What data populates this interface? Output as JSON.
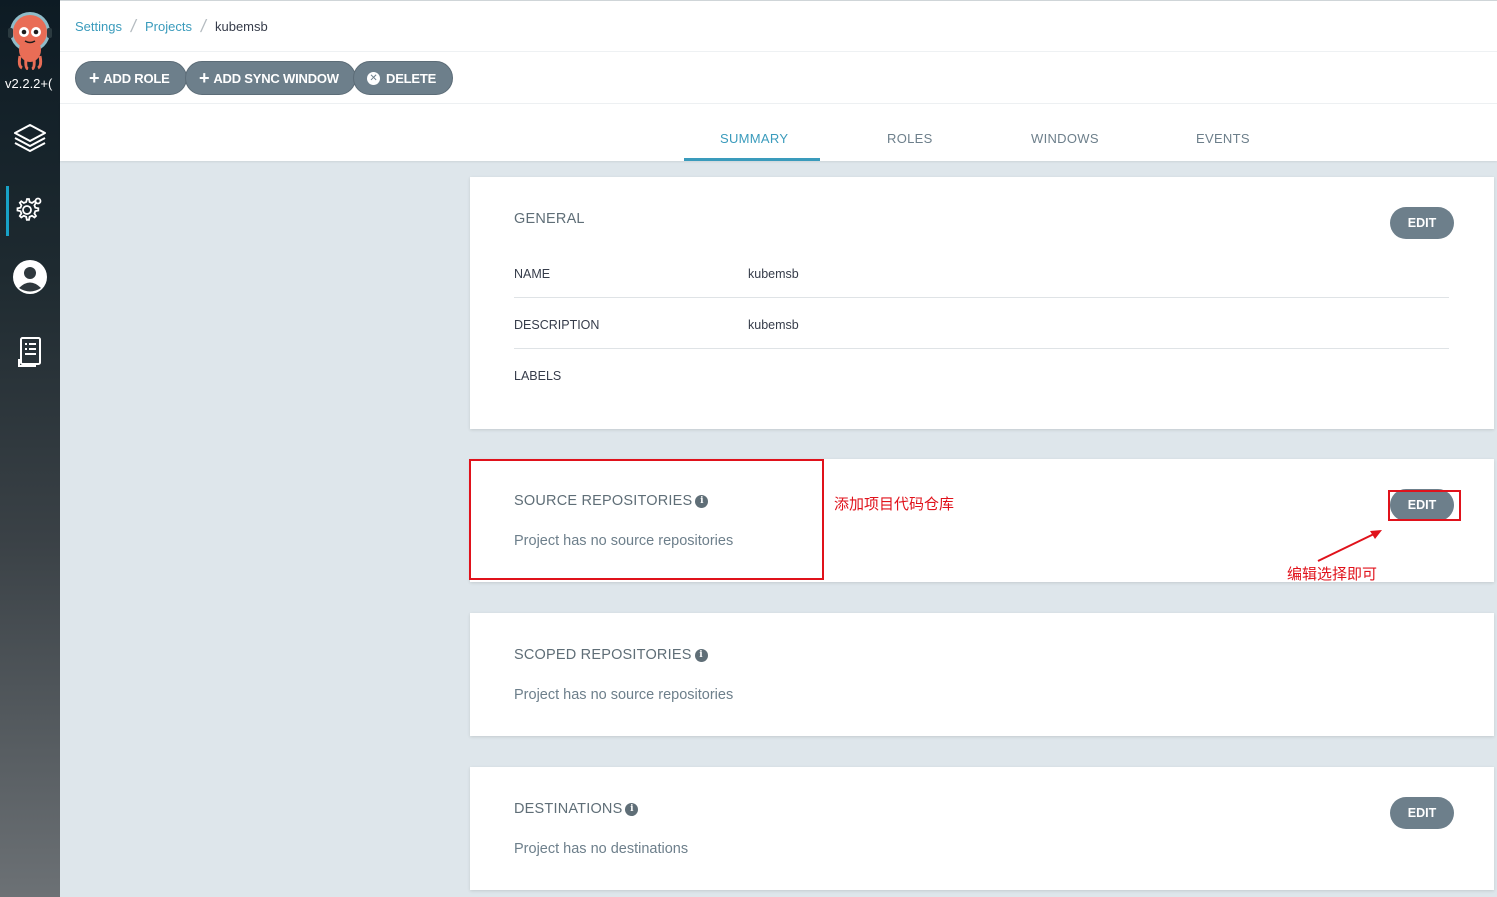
{
  "app": {
    "version": "v2.2.2+("
  },
  "sidebar": {
    "items": [
      {
        "icon": "layers-icon"
      },
      {
        "icon": "gear-icon",
        "active": true
      },
      {
        "icon": "user-icon"
      },
      {
        "icon": "docs-icon"
      }
    ],
    "accent": "#18a2c7"
  },
  "breadcrumb": {
    "settings": "Settings",
    "projects": "Projects",
    "current": "kubemsb"
  },
  "toolbar": {
    "add_role": "ADD ROLE",
    "add_sync_window": "ADD SYNC WINDOW",
    "delete": "DELETE"
  },
  "tabs": {
    "summary": "SUMMARY",
    "roles": "ROLES",
    "windows": "WINDOWS",
    "events": "EVENTS",
    "active": "summary"
  },
  "general": {
    "title": "GENERAL",
    "edit_label": "EDIT",
    "name_key": "NAME",
    "name_value": "kubemsb",
    "description_key": "DESCRIPTION",
    "description_value": "kubemsb",
    "labels_key": "LABELS"
  },
  "source_repos": {
    "title": "SOURCE REPOSITORIES",
    "empty": "Project has no source repositories",
    "edit_label": "EDIT"
  },
  "scoped_repos": {
    "title": "SCOPED REPOSITORIES",
    "empty": "Project has no source repositories"
  },
  "destinations": {
    "title": "DESTINATIONS",
    "empty": "Project has no destinations",
    "edit_label": "EDIT"
  },
  "annotations": {
    "add_repo_note": "添加项目代码仓库",
    "edit_note": "编辑选择即可",
    "color": "#e0121b"
  },
  "colors": {
    "link": "#3a9bbc",
    "button": "#6d7f8b",
    "background": "#dee6eb"
  }
}
